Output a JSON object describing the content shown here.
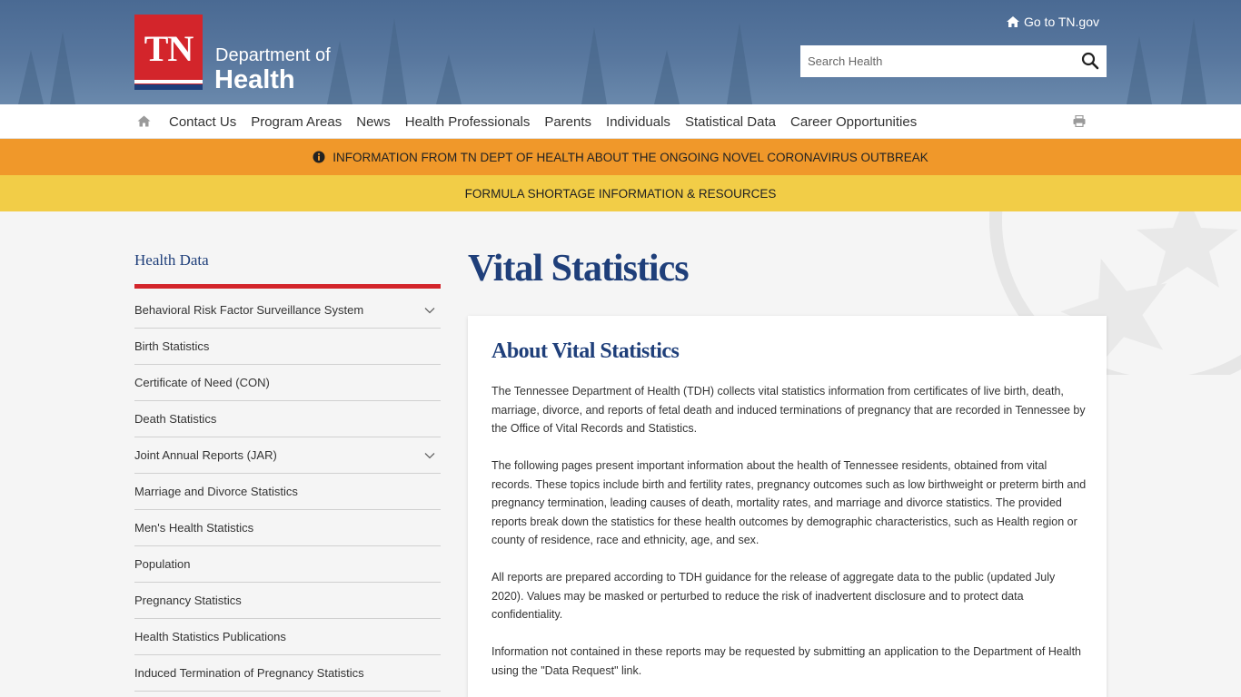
{
  "header": {
    "logo_letters": "TN",
    "logo_line1": "Department of",
    "logo_line2": "Health",
    "goto_link": "Go to TN.gov",
    "search_placeholder": "Search Health"
  },
  "nav": {
    "items": [
      "Contact Us",
      "Program Areas",
      "News",
      "Health Professionals",
      "Parents",
      "Individuals",
      "Statistical Data",
      "Career Opportunities"
    ]
  },
  "banners": {
    "orange": "INFORMATION FROM TN DEPT OF HEALTH ABOUT THE ONGOING NOVEL CORONAVIRUS OUTBREAK",
    "yellow": "FORMULA SHORTAGE INFORMATION & RESOURCES"
  },
  "sidebar": {
    "title": "Health Data",
    "items": [
      {
        "label": "Behavioral Risk Factor Surveillance System",
        "expandable": true
      },
      {
        "label": "Birth Statistics",
        "expandable": false
      },
      {
        "label": "Certificate of Need (CON)",
        "expandable": false
      },
      {
        "label": "Death Statistics",
        "expandable": false
      },
      {
        "label": "Joint Annual Reports (JAR)",
        "expandable": true
      },
      {
        "label": "Marriage and Divorce Statistics",
        "expandable": false
      },
      {
        "label": "Men's Health Statistics",
        "expandable": false
      },
      {
        "label": "Population",
        "expandable": false
      },
      {
        "label": "Pregnancy Statistics",
        "expandable": false
      },
      {
        "label": "Health Statistics Publications",
        "expandable": false
      },
      {
        "label": "Induced Termination of Pregnancy Statistics",
        "expandable": false
      }
    ]
  },
  "main": {
    "title": "Vital Statistics",
    "card_title": "About Vital Statistics",
    "paragraphs": [
      "The Tennessee Department of Health (TDH) collects vital statistics information from certificates of live birth, death, marriage, divorce, and reports of fetal death and induced terminations of pregnancy that are recorded in Tennessee by the Office of Vital Records and Statistics.",
      "The following pages present important information about the health of Tennessee residents, obtained from vital records. These topics include birth and fertility rates, pregnancy outcomes such as low birthweight or preterm birth and pregnancy termination, leading causes of death, mortality rates, and marriage and divorce statistics. The provided reports break down the statistics for these health outcomes by demographic characteristics, such as Health region or county of residence, race and ethnicity, age, and sex.",
      "All reports are prepared according to TDH guidance for the release of aggregate data to the public (updated July 2020). Values may be masked or perturbed to reduce the risk of inadvertent disclosure and to protect data confidentiality.",
      "Information not contained in these reports may be requested by submitting an application to the Department of Health using the \"Data Request\" link."
    ]
  },
  "colors": {
    "brand_red": "#d3252b",
    "brand_navy": "#1f3f7a",
    "banner_orange": "#f0982a",
    "banner_yellow": "#f2cd47"
  },
  "icons": {
    "home": "home-icon",
    "search": "search-icon",
    "print": "print-icon",
    "info": "info-icon",
    "chevron": "chevron-down-icon"
  }
}
